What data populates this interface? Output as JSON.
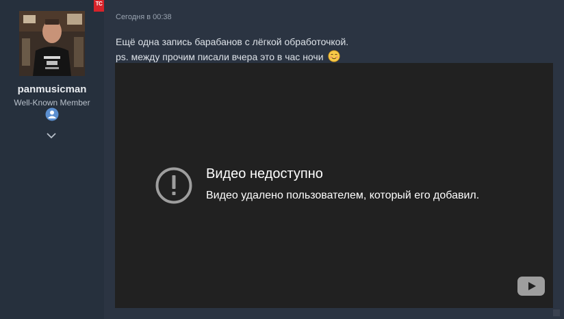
{
  "sidebar": {
    "username": "panmusicman",
    "user_title": "Well-Known Member",
    "avatar_icon": "user-avatar-photo",
    "badge_icon": "member-badge-icon",
    "expand_icon": "chevron-down-icon",
    "forum_logo": "TC"
  },
  "post": {
    "timestamp": "Сегодня в 00:38",
    "line1": "Ещё одна запись барабанов с лёгкой обработочкой.",
    "line2": "ps. между прочим писали вчера это в час ночи",
    "emoji_icon": "smiling-blush-emoji"
  },
  "video": {
    "title": "Видео недоступно",
    "message": "Видео удалено пользователем, который его добавил.",
    "warning_icon": "exclamation-circle-icon",
    "logo_icon": "youtube-logo-icon"
  },
  "colors": {
    "page_bg": "#2b3442",
    "sidebar_bg": "#26303d",
    "video_bg": "#212121",
    "accent_red": "#d8232a"
  }
}
